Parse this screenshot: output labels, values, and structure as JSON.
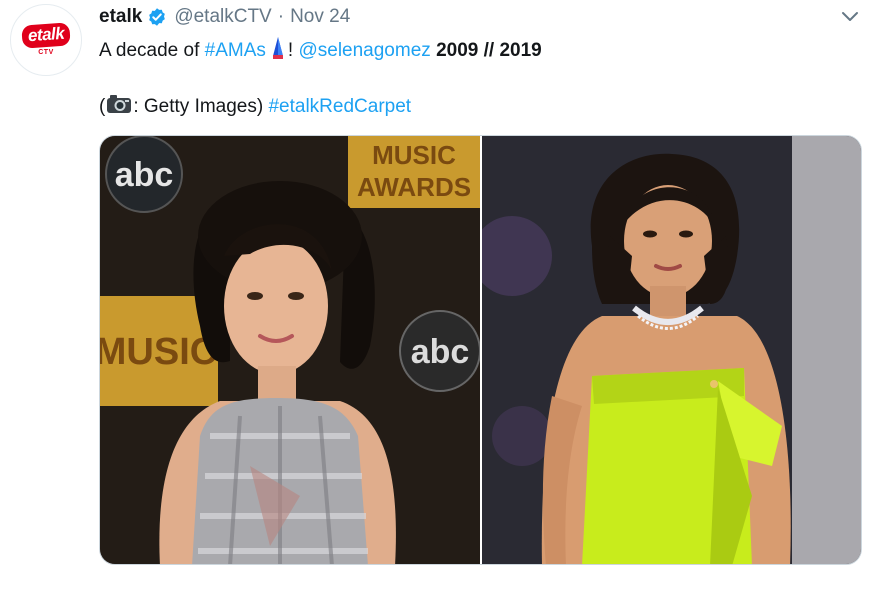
{
  "account": {
    "avatar_top": "etalk",
    "avatar_bottom": "CTV",
    "name": "etalk",
    "handle": "@etalkCTV",
    "separator": "·",
    "date": "Nov 24"
  },
  "tweet": {
    "text_prefix": "A decade of ",
    "hashtag_amas": "#AMAs",
    "exclaim": "! ",
    "mention": "@selenagomez",
    "years": "2009 // 2019",
    "credit_open": "(",
    "credit_text": ": Getty Images) ",
    "hashtag_red": "#etalkRedCarpet"
  },
  "media": {
    "left_logo": "abc",
    "left_banner_top": "MUSIC",
    "left_banner_bottom": "AWARDS",
    "left_side_text": "MUSIC",
    "left_abc": "abc"
  },
  "colors": {
    "link": "#1da1f2",
    "secondary": "#657786",
    "brand": "#e0001b"
  },
  "icons": [
    "verified-badge-icon",
    "chevron-down-icon",
    "amas-trophy-icon",
    "camera-icon"
  ]
}
